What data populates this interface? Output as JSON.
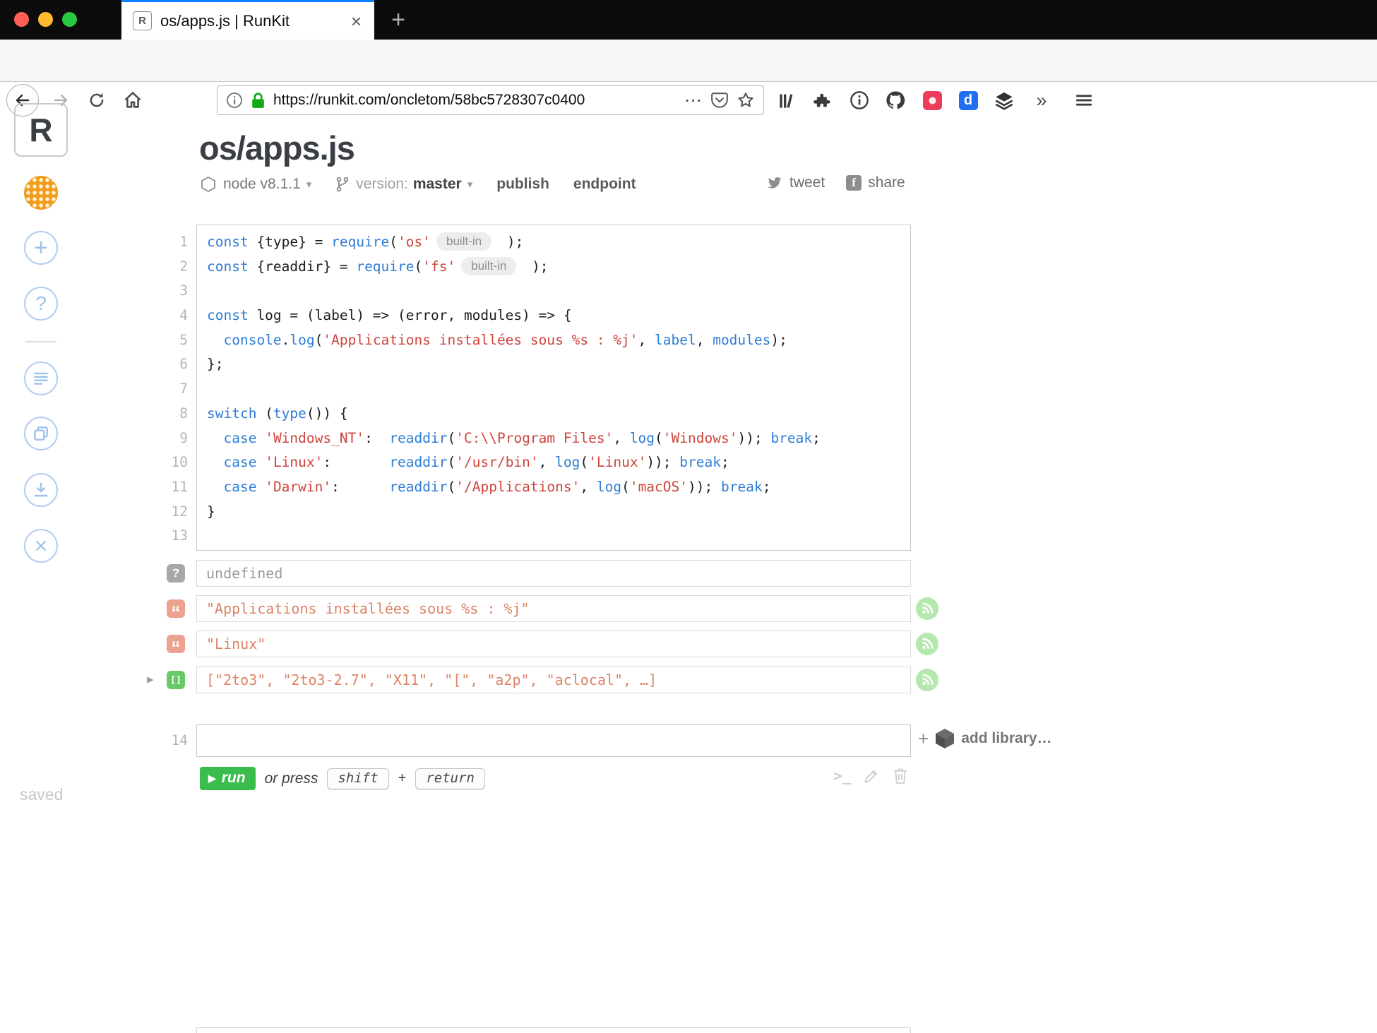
{
  "browser": {
    "tab_title": "os/apps.js | RunKit",
    "tab_favicon": "R",
    "new_tab": "+",
    "url": "https://runkit.com/oncletom/58bc5728307c0400",
    "ellipsis": "⋯",
    "overflow": "»",
    "devdocs_letter": "d",
    "toolbar_icons": [
      "back-icon",
      "forward-icon",
      "reload-icon",
      "home-icon",
      "info-icon",
      "lock-icon",
      "pocket-icon",
      "star-icon",
      "library-icon",
      "extensions-icon",
      "info-circle-icon",
      "github-icon",
      "red-extension-icon",
      "devdocs-icon",
      "layers-icon",
      "overflow-icon",
      "menu-icon"
    ]
  },
  "sidebar": {
    "logo": "R",
    "saved": "saved",
    "plus": "+",
    "question": "?"
  },
  "notebook": {
    "title": "os/apps.js",
    "node_version": "node v8.1.1",
    "version_label": "version:",
    "version_value": "master",
    "publish": "publish",
    "endpoint": "endpoint",
    "tweet": "tweet",
    "share": "share",
    "caret": "▾"
  },
  "editor": {
    "lines": [
      [
        [
          "const",
          "k"
        ],
        [
          " {type} = ",
          "p"
        ],
        [
          "require",
          "k"
        ],
        [
          "(",
          "p"
        ],
        [
          "'os'",
          "s"
        ],
        [
          "built-in",
          "pill"
        ],
        [
          " );",
          "p"
        ]
      ],
      [
        [
          "const",
          "k"
        ],
        [
          " {readdir} = ",
          "p"
        ],
        [
          "require",
          "k"
        ],
        [
          "(",
          "p"
        ],
        [
          "'fs'",
          "s"
        ],
        [
          "built-in",
          "pill"
        ],
        [
          " );",
          "p"
        ]
      ],
      [],
      [
        [
          "const",
          "k"
        ],
        [
          " log = (label) => (error, modules) => {",
          "p"
        ]
      ],
      [
        [
          "  ",
          "p"
        ],
        [
          "console",
          "k"
        ],
        [
          ".",
          "p"
        ],
        [
          "log",
          "k"
        ],
        [
          "(",
          "p"
        ],
        [
          "'Applications installées sous %s : %j'",
          "s"
        ],
        [
          ", ",
          "p"
        ],
        [
          "label",
          "v"
        ],
        [
          ", ",
          "p"
        ],
        [
          "modules",
          "v"
        ],
        [
          ");",
          "p"
        ]
      ],
      [
        [
          "};",
          "p"
        ]
      ],
      [],
      [
        [
          "switch",
          "k"
        ],
        [
          " (",
          "p"
        ],
        [
          "type",
          "k"
        ],
        [
          "()) {",
          "p"
        ]
      ],
      [
        [
          "  ",
          "p"
        ],
        [
          "case",
          "k"
        ],
        [
          " ",
          "p"
        ],
        [
          "'Windows_NT'",
          "s"
        ],
        [
          ":  ",
          "p"
        ],
        [
          "readdir",
          "k"
        ],
        [
          "(",
          "p"
        ],
        [
          "'C:\\\\Program Files'",
          "s"
        ],
        [
          ", ",
          "p"
        ],
        [
          "log",
          "k"
        ],
        [
          "(",
          "p"
        ],
        [
          "'Windows'",
          "s"
        ],
        [
          ")); ",
          "p"
        ],
        [
          "break",
          "k"
        ],
        [
          ";",
          "p"
        ]
      ],
      [
        [
          "  ",
          "p"
        ],
        [
          "case",
          "k"
        ],
        [
          " ",
          "p"
        ],
        [
          "'Linux'",
          "s"
        ],
        [
          ":       ",
          "p"
        ],
        [
          "readdir",
          "k"
        ],
        [
          "(",
          "p"
        ],
        [
          "'/usr/bin'",
          "s"
        ],
        [
          ", ",
          "p"
        ],
        [
          "log",
          "k"
        ],
        [
          "(",
          "p"
        ],
        [
          "'Linux'",
          "s"
        ],
        [
          ")); ",
          "p"
        ],
        [
          "break",
          "k"
        ],
        [
          ";",
          "p"
        ]
      ],
      [
        [
          "  ",
          "p"
        ],
        [
          "case",
          "k"
        ],
        [
          " ",
          "p"
        ],
        [
          "'Darwin'",
          "s"
        ],
        [
          ":      ",
          "p"
        ],
        [
          "readdir",
          "k"
        ],
        [
          "(",
          "p"
        ],
        [
          "'/Applications'",
          "s"
        ],
        [
          ", ",
          "p"
        ],
        [
          "log",
          "k"
        ],
        [
          "(",
          "p"
        ],
        [
          "'macOS'",
          "s"
        ],
        [
          ")); ",
          "p"
        ],
        [
          "break",
          "k"
        ],
        [
          ";",
          "p"
        ]
      ],
      [
        [
          "}",
          "p"
        ]
      ],
      []
    ]
  },
  "outputs": [
    {
      "kind": "undefined",
      "icon": "question",
      "text": "undefined",
      "rss": false,
      "expander": false
    },
    {
      "kind": "string",
      "icon": "quote",
      "text": "\"Applications installées sous %s : %j\"",
      "rss": true,
      "expander": false
    },
    {
      "kind": "string",
      "icon": "quote",
      "text": "\"Linux\"",
      "rss": true,
      "expander": false
    },
    {
      "kind": "array",
      "icon": "brackets",
      "text": "[\"2to3\", \"2to3-2.7\", \"X11\", \"[\", \"a2p\", \"aclocal\", …]",
      "rss": true,
      "expander": true
    }
  ],
  "footer_cell": {
    "line_number": "14",
    "run_label": "run",
    "run_triangle": "▶",
    "or_press": "or press",
    "shift_key": "shift",
    "plus": "+",
    "return_key": "return",
    "add_library_plus": "+",
    "add_library": "add library…",
    "prompt": ">_"
  },
  "colors": {
    "keyword_blue": "#2e7cd6",
    "string_red": "#ce453c",
    "output_orange": "#dd8365",
    "run_green": "#3bbd4e",
    "tab_accent": "#0a84ff",
    "rss_green": "#b5e8ae"
  }
}
